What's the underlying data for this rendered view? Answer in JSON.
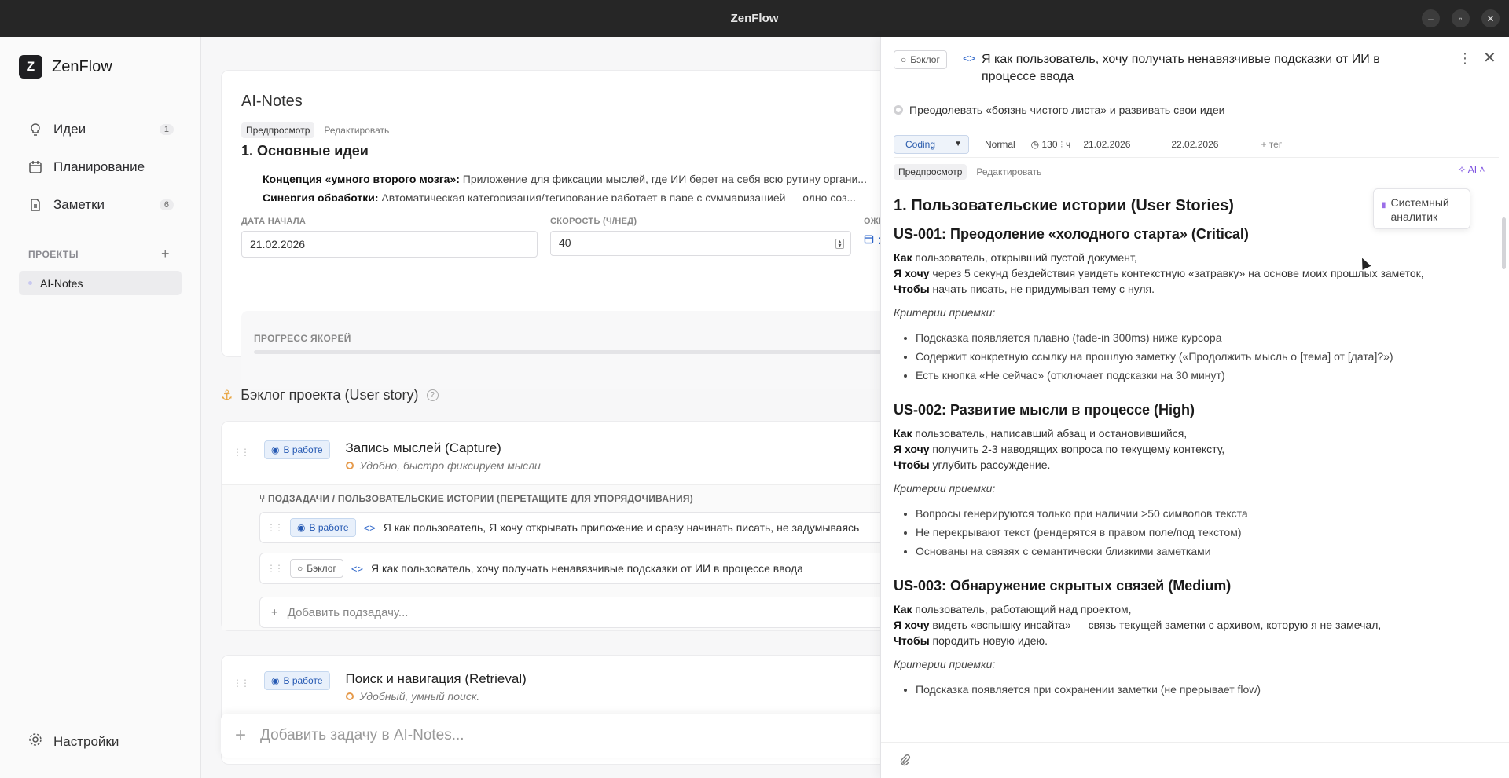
{
  "window": {
    "title": "ZenFlow"
  },
  "sidebar": {
    "brand": {
      "logo": "Z",
      "name": "ZenFlow"
    },
    "items": [
      {
        "label": "Идеи",
        "count": "1",
        "icon": "lightbulb-icon"
      },
      {
        "label": "Планирование",
        "count": "",
        "icon": "calendar-icon"
      },
      {
        "label": "Заметки",
        "count": "6",
        "icon": "document-icon"
      }
    ],
    "projects_label": "ПРОЕКТЫ",
    "projects": [
      {
        "label": "AI-Notes"
      }
    ],
    "settings_label": "Настройки"
  },
  "project": {
    "title": "AI-Notes",
    "tabs": {
      "preview": "Предпросмотр",
      "edit": "Редактировать"
    },
    "heading": "1. Основные идеи",
    "bullets": [
      {
        "bold": "Концепция «умного второго мозга»:",
        "text": " Приложение для фиксации мыслей, где ИИ берет на себя всю рутину органи..."
      },
      {
        "bold": "Синергия обработки:",
        "text": " Автоматическая категоризация/тегирование работает в паре с суммаризацией — одно соз..."
      }
    ],
    "start_date": {
      "label": "ДАТА НАЧАЛА",
      "value": "21.02.2026"
    },
    "speed": {
      "label": "СКОРОСТЬ (Ч/НЕД)",
      "value": "40"
    },
    "expected": {
      "label": "ОЖИ",
      "value": "2"
    },
    "progress_label": "ПРОГРЕСС ЯКОРЕЙ",
    "progress_value": 0
  },
  "backlog": {
    "title": "Бэклог проекта (User story)",
    "subtasks_header": "ПОДЗАДАЧИ / ПОЛЬЗОВАТЕЛЬСКИЕ ИСТОРИИ (ПЕРЕТАЩИТЕ ДЛЯ УПОРЯДОЧИВАНИЯ)",
    "add_subtask": "Добавить подзадачу...",
    "stories": [
      {
        "status": "В работе",
        "title": "Запись мыслей (Capture)",
        "subtitle": "Удобно, быстро фиксируем мысли",
        "subtasks": [
          {
            "status": "В работе",
            "text": "Я как пользователь, Я хочу открывать приложение и сразу начинать писать, не задумываясь"
          },
          {
            "status": "Бэклог",
            "text": "Я как пользователь, хочу получать ненавязчивые подсказки от ИИ в процессе ввода"
          }
        ]
      },
      {
        "status": "В работе",
        "title": "Поиск и навигация (Retrieval)",
        "subtitle": "Удобный, умный поиск."
      }
    ],
    "add_task": "Добавить задачу в AI-Notes..."
  },
  "panel": {
    "status": "Бэклог",
    "title": "Я как пользователь, хочу получать ненавязчивые подсказки от ИИ в процессе ввода",
    "goal": "Преодолевать «боязнь чистого листа» и развивать свои идеи",
    "type": "Coding",
    "priority": "Normal",
    "hours": "130",
    "hours_unit": "ч",
    "date_start": "21.02.2026",
    "date_end": "22.02.2026",
    "tag": "+ тег",
    "tabs": {
      "preview": "Предпросмотр",
      "edit": "Редактировать"
    },
    "ai_label": "AI",
    "ai_popup": "Системный аналитик",
    "doc": {
      "h1": "1. Пользовательские истории (User Stories)",
      "criteria_label": "Критерии приемки:",
      "stories": [
        {
          "title": "US-001: Преодоление «холодного старта» (Critical)",
          "as": "Как",
          "as_text": " пользователь, открывший пустой документ,",
          "want": "Я хочу",
          "want_text": " через 5 секунд бездействия увидеть контекстную «затравку» на основе моих прошлых заметок,",
          "so": "Чтобы",
          "so_text": " начать писать, не придумывая тему с нуля.",
          "criteria": [
            "Подсказка появляется плавно (fade-in 300ms) ниже курсора",
            "Содержит конкретную ссылку на прошлую заметку («Продолжить мысль о [тема] от [дата]?»)",
            "Есть кнопка «Не сейчас» (отключает подсказки на 30 минут)"
          ]
        },
        {
          "title": "US-002: Развитие мысли в процессе (High)",
          "as": "Как",
          "as_text": " пользователь, написавший абзац и остановившийся,",
          "want": "Я хочу",
          "want_text": " получить 2-3 наводящих вопроса по текущему контексту,",
          "so": "Чтобы",
          "so_text": " углубить рассуждение.",
          "criteria": [
            "Вопросы генерируются только при наличии >50 символов текста",
            "Не перекрывают текст (рендерятся в правом поле/под текстом)",
            "Основаны на связях с семантически близкими заметками"
          ]
        },
        {
          "title": "US-003: Обнаружение скрытых связей (Medium)",
          "as": "Как",
          "as_text": " пользователь, работающий над проектом,",
          "want": "Я хочу",
          "want_text": " видеть «вспышку инсайта» — связь текущей заметки с архивом, которую я не замечал,",
          "so": "Чтобы",
          "so_text": " породить новую идею.",
          "criteria": [
            "Подсказка появляется при сохранении заметки (не прерывает flow)"
          ]
        }
      ]
    }
  }
}
